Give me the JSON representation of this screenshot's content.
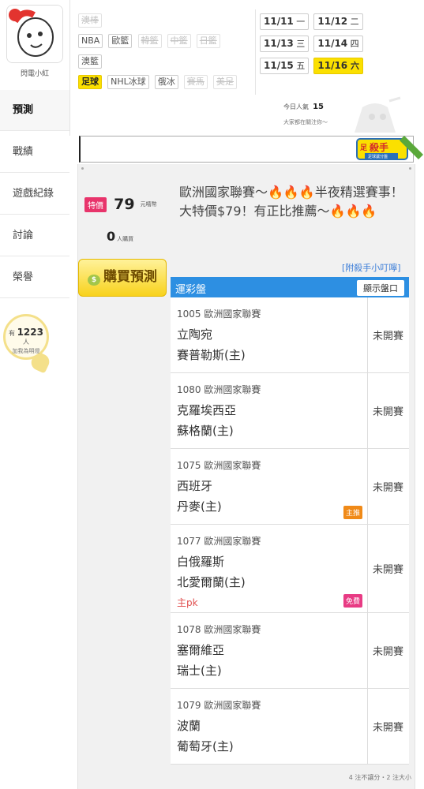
{
  "user": {
    "name": "閃電小紅"
  },
  "nav": [
    "預測",
    "戰績",
    "遊戲紀錄",
    "討論",
    "榮譽"
  ],
  "fans": {
    "prefix": "有",
    "count": "1223",
    "unit": "人",
    "cta": "加我為明燈"
  },
  "sports": {
    "row1": [
      {
        "label": "澳棒",
        "state": "off"
      }
    ],
    "row2": [
      {
        "label": "NBA",
        "state": "on"
      },
      {
        "label": "歐籃",
        "state": "on"
      },
      {
        "label": "韓籃",
        "state": "off"
      },
      {
        "label": "中籃",
        "state": "off"
      },
      {
        "label": "日籃",
        "state": "off"
      }
    ],
    "row3": [
      {
        "label": "澳籃",
        "state": "on"
      }
    ],
    "row4": [
      {
        "label": "足球",
        "state": "active"
      },
      {
        "label": "NHL冰球",
        "state": "on"
      },
      {
        "label": "俄冰",
        "state": "on"
      },
      {
        "label": "賽馬",
        "state": "off"
      },
      {
        "label": "美足",
        "state": "off"
      }
    ]
  },
  "dates": [
    {
      "date": "11/11",
      "day": "一"
    },
    {
      "date": "11/12",
      "day": "二"
    },
    {
      "date": "11/13",
      "day": "三"
    },
    {
      "date": "11/14",
      "day": "四"
    },
    {
      "date": "11/15",
      "day": "五"
    },
    {
      "date": "11/16",
      "day": "六",
      "active": true
    }
  ],
  "popularity": {
    "label": "今日人氣",
    "value": "15",
    "sub": "大家都在關注你～"
  },
  "badge": {
    "title": "殺手",
    "sub": "足球讓分盤"
  },
  "offer": {
    "tag": "特價",
    "price": "79",
    "unit": "元嘻幣",
    "buyers": "0",
    "buyers_unit": "人購買",
    "description": "歐洲國家聯賽～🔥🔥🔥半夜精選賽事！大特價$79！有正比推薦～🔥🔥🔥",
    "buy_label": "購買預測",
    "killer_link": "[附殺手小叮嚀]"
  },
  "table": {
    "title": "運彩盤",
    "show_odds": "顯示盤口"
  },
  "games": [
    {
      "league": "1005 歐洲國家聯賽",
      "team_a": "立陶宛",
      "team_b": "賽普勒斯(主)",
      "status": "未開賽"
    },
    {
      "league": "1080 歐洲國家聯賽",
      "team_a": "克羅埃西亞",
      "team_b": "蘇格蘭(主)",
      "status": "未開賽"
    },
    {
      "league": "1075 歐洲國家聯賽",
      "team_a": "西班牙",
      "team_b": "丹麥(主)",
      "status": "未開賽",
      "badge": "主推",
      "badge_color": "#f08a18"
    },
    {
      "league": "1077 歐洲國家聯賽",
      "team_a": "白俄羅斯",
      "team_b": "北愛爾蘭(主)",
      "status": "未開賽",
      "extra": "主pk",
      "badge": "免費",
      "badge_color": "#e83b84"
    },
    {
      "league": "1078 歐洲國家聯賽",
      "team_a": "塞爾維亞",
      "team_b": "瑞士(主)",
      "status": "未開賽"
    },
    {
      "league": "1079 歐洲國家聯賽",
      "team_a": "波蘭",
      "team_b": "葡萄牙(主)",
      "status": "未開賽"
    }
  ],
  "footer_note": "4 注不讓分・2 注大小"
}
